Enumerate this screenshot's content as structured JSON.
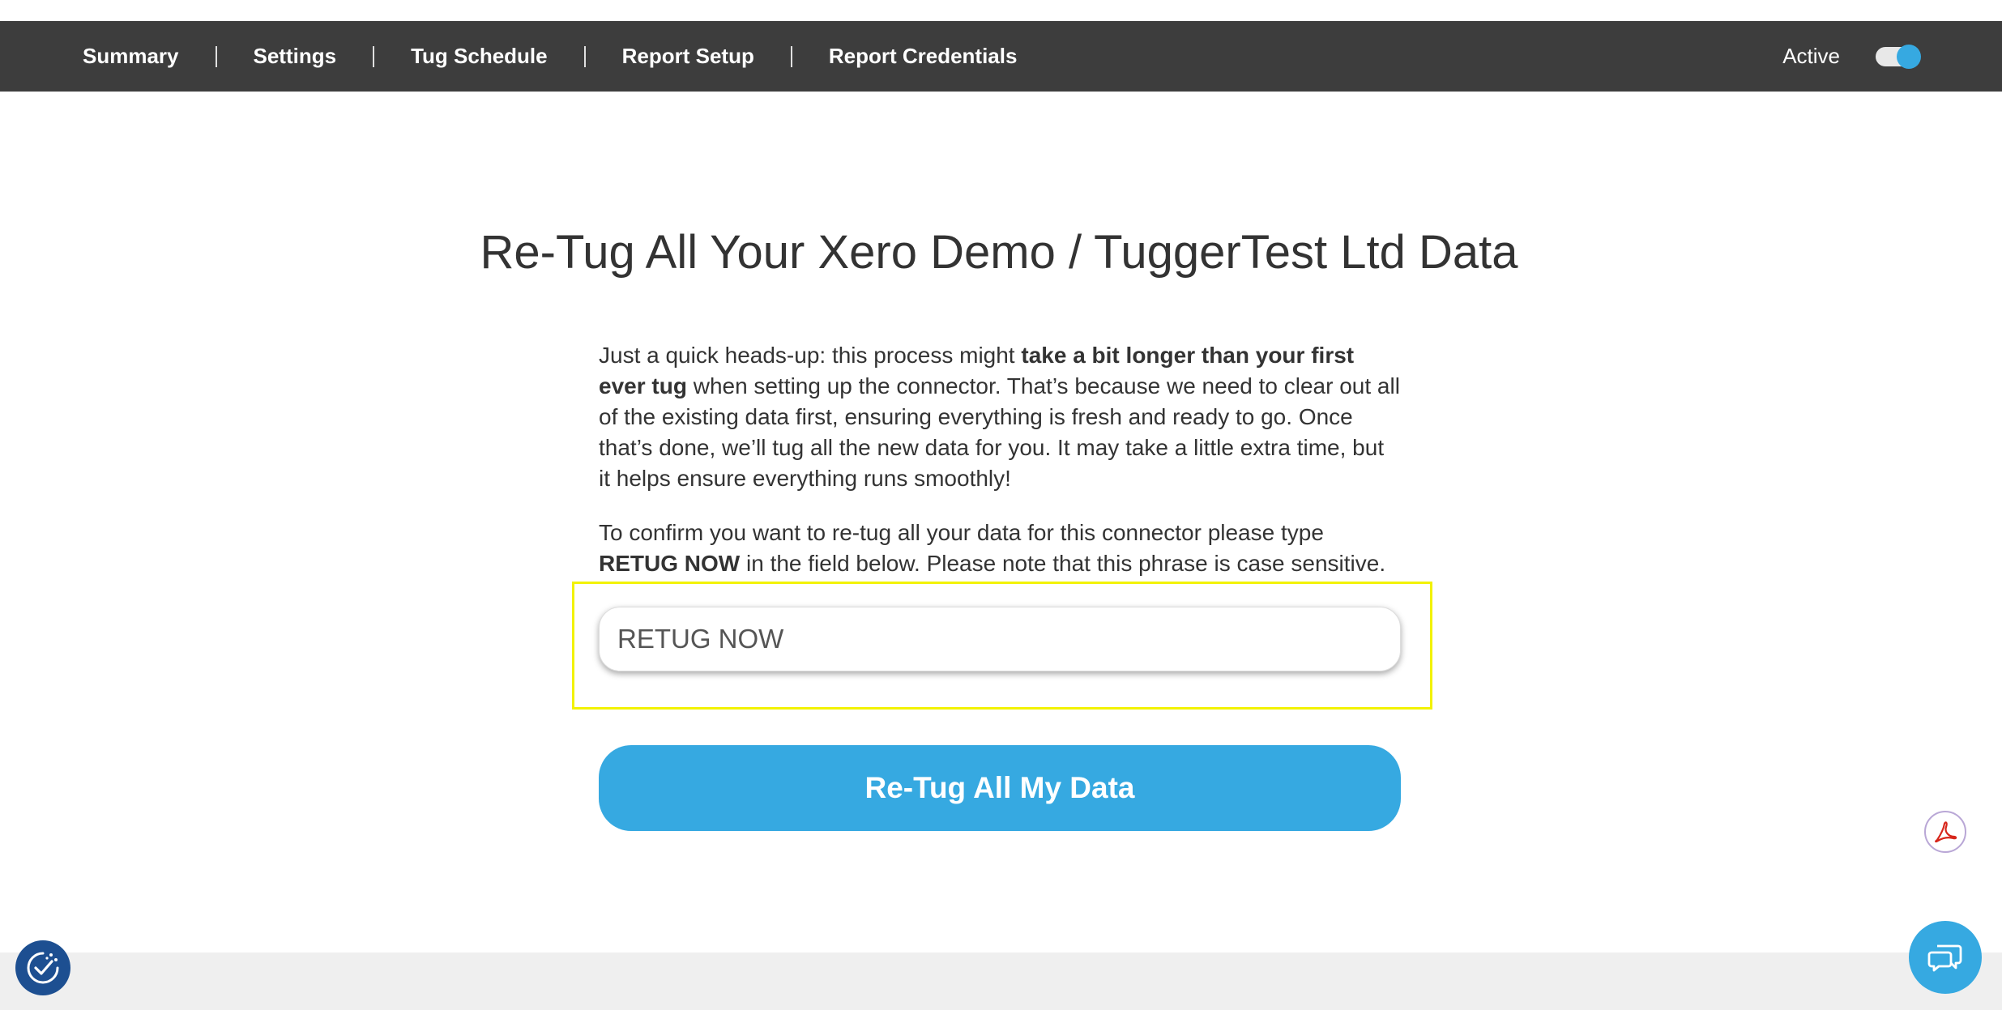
{
  "nav": {
    "items": [
      {
        "label": "Summary"
      },
      {
        "label": "Settings"
      },
      {
        "label": "Tug Schedule"
      },
      {
        "label": "Report Setup"
      },
      {
        "label": "Report Credentials"
      }
    ],
    "active_label": "Active",
    "active_toggle_on": true
  },
  "main": {
    "heading": "Re-Tug All Your Xero Demo / TuggerTest Ltd Data",
    "intro": {
      "part1": "Just a quick heads-up: this process might ",
      "bold": "take a bit longer than your first ever tug",
      "part2": " when setting up the connector. That’s because we need to clear out all of the existing data first, ensuring everything is fresh and ready to go. Once that’s done, we’ll tug all the new data for you. It may take a little extra time, but it helps ensure everything runs smoothly!"
    },
    "confirm": {
      "part1": "To confirm you want to re-tug all your data for this connector please type ",
      "bold": "RETUG NOW",
      "part2": " in the field below. Please note that this phrase is case sensitive."
    },
    "input_value": "RETUG NOW",
    "button_label": "Re-Tug All My Data"
  },
  "colors": {
    "nav_bg": "#3d3d3d",
    "accent": "#36a9e1",
    "highlight": "#f2f200",
    "consent_bg": "#1d4f91",
    "pdf_red": "#d7261b"
  },
  "icons": {
    "pdf": "acrobat-pdf-icon",
    "consent": "cookie-consent-check-icon",
    "chat": "chat-bubbles-icon"
  }
}
